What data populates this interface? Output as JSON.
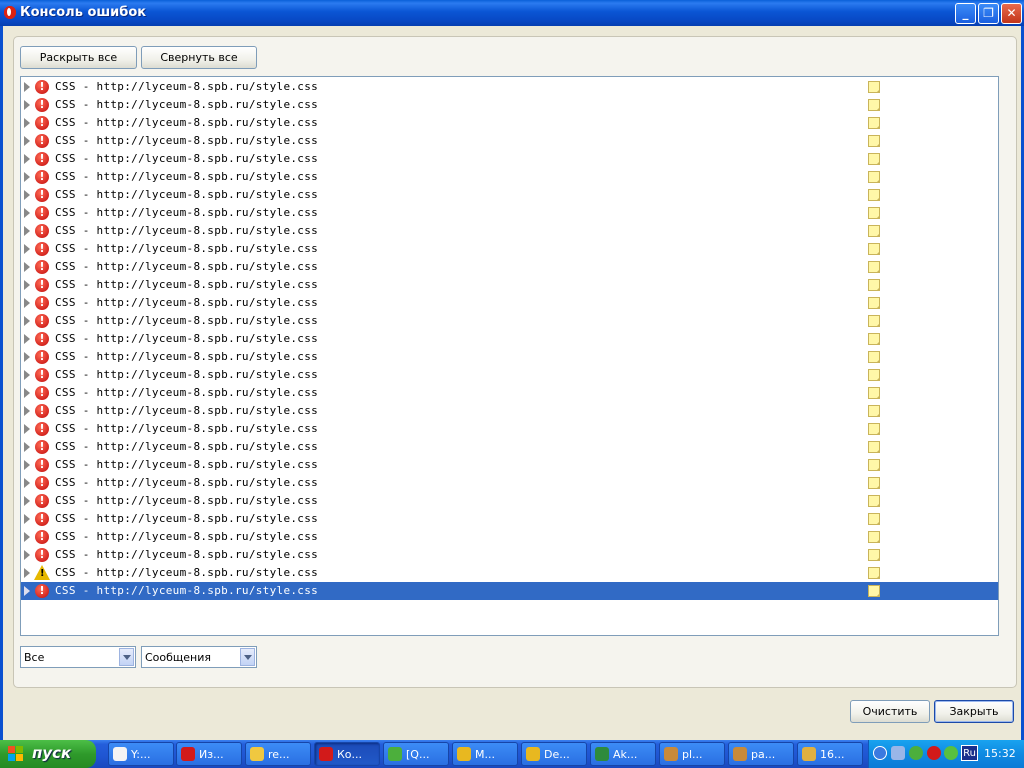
{
  "window": {
    "title": "Консоль ошибок",
    "controls": {
      "minimize": "_",
      "maximize": "❐",
      "close": "✕"
    }
  },
  "toolbar": {
    "expand_all": "Раскрыть все",
    "collapse_all": "Свернуть все"
  },
  "log": {
    "entries": [
      {
        "type": "error",
        "text": "CSS - http://lyceum-8.spb.ru/style.css"
      },
      {
        "type": "error",
        "text": "CSS - http://lyceum-8.spb.ru/style.css"
      },
      {
        "type": "error",
        "text": "CSS - http://lyceum-8.spb.ru/style.css"
      },
      {
        "type": "error",
        "text": "CSS - http://lyceum-8.spb.ru/style.css"
      },
      {
        "type": "error",
        "text": "CSS - http://lyceum-8.spb.ru/style.css"
      },
      {
        "type": "error",
        "text": "CSS - http://lyceum-8.spb.ru/style.css"
      },
      {
        "type": "error",
        "text": "CSS - http://lyceum-8.spb.ru/style.css"
      },
      {
        "type": "error",
        "text": "CSS - http://lyceum-8.spb.ru/style.css"
      },
      {
        "type": "error",
        "text": "CSS - http://lyceum-8.spb.ru/style.css"
      },
      {
        "type": "error",
        "text": "CSS - http://lyceum-8.spb.ru/style.css"
      },
      {
        "type": "error",
        "text": "CSS - http://lyceum-8.spb.ru/style.css"
      },
      {
        "type": "error",
        "text": "CSS - http://lyceum-8.spb.ru/style.css"
      },
      {
        "type": "error",
        "text": "CSS - http://lyceum-8.spb.ru/style.css"
      },
      {
        "type": "error",
        "text": "CSS - http://lyceum-8.spb.ru/style.css"
      },
      {
        "type": "error",
        "text": "CSS - http://lyceum-8.spb.ru/style.css"
      },
      {
        "type": "error",
        "text": "CSS - http://lyceum-8.spb.ru/style.css"
      },
      {
        "type": "error",
        "text": "CSS - http://lyceum-8.spb.ru/style.css"
      },
      {
        "type": "error",
        "text": "CSS - http://lyceum-8.spb.ru/style.css"
      },
      {
        "type": "error",
        "text": "CSS - http://lyceum-8.spb.ru/style.css"
      },
      {
        "type": "error",
        "text": "CSS - http://lyceum-8.spb.ru/style.css"
      },
      {
        "type": "error",
        "text": "CSS - http://lyceum-8.spb.ru/style.css"
      },
      {
        "type": "error",
        "text": "CSS - http://lyceum-8.spb.ru/style.css"
      },
      {
        "type": "error",
        "text": "CSS - http://lyceum-8.spb.ru/style.css"
      },
      {
        "type": "error",
        "text": "CSS - http://lyceum-8.spb.ru/style.css"
      },
      {
        "type": "error",
        "text": "CSS - http://lyceum-8.spb.ru/style.css"
      },
      {
        "type": "error",
        "text": "CSS - http://lyceum-8.spb.ru/style.css"
      },
      {
        "type": "error",
        "text": "CSS - http://lyceum-8.spb.ru/style.css"
      },
      {
        "type": "warning",
        "text": "CSS - http://lyceum-8.spb.ru/style.css"
      },
      {
        "type": "error",
        "text": "CSS - http://lyceum-8.spb.ru/style.css",
        "selected": true
      }
    ]
  },
  "filters": {
    "source": "Все",
    "kind": "Сообщения"
  },
  "footer": {
    "clear": "Очистить",
    "close": "Закрыть"
  },
  "taskbar": {
    "start": "пуск",
    "tasks": [
      {
        "label": "Y:...",
        "icon": "notepad-icon",
        "color": "#f4f4f4"
      },
      {
        "label": "Из...",
        "icon": "opera-icon",
        "color": "#d21a1a"
      },
      {
        "label": "re...",
        "icon": "folder-icon",
        "color": "#f0c840"
      },
      {
        "label": "Ко...",
        "icon": "opera-icon",
        "color": "#d21a1a",
        "active": true
      },
      {
        "label": "[Q...",
        "icon": "qip-icon",
        "color": "#4caf3c"
      },
      {
        "label": "M...",
        "icon": "chrome-icon",
        "color": "#e8b820"
      },
      {
        "label": "De...",
        "icon": "chrome-icon",
        "color": "#e8b820"
      },
      {
        "label": "Ak...",
        "icon": "book-icon",
        "color": "#2e8b3c"
      },
      {
        "label": "pl...",
        "icon": "gimp-icon",
        "color": "#c88a3a"
      },
      {
        "label": "pa...",
        "icon": "gimp-icon",
        "color": "#c88a3a"
      },
      {
        "label": "16...",
        "icon": "pencil-icon",
        "color": "#e0b040"
      }
    ],
    "tray": {
      "lang": "Ru",
      "clock": "15:32"
    }
  }
}
